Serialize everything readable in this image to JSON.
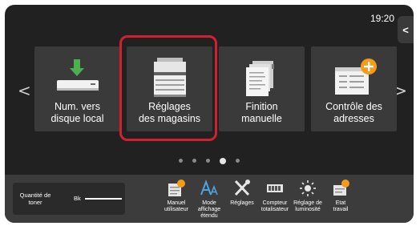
{
  "status": {
    "time": "19:20"
  },
  "side_panel": {
    "toggle_glyph": "<"
  },
  "nav": {
    "prev_glyph": "<",
    "next_glyph": ">"
  },
  "tiles": [
    {
      "label": "Num. vers\ndisque local",
      "icon": "scan-to-local-drive-icon",
      "accent": "#4caf50"
    },
    {
      "label": "Réglages\ndes magasins",
      "icon": "paper-tray-settings-icon",
      "highlighted": true,
      "highlight_color": "#d3202f"
    },
    {
      "label": "Finition\nmanuelle",
      "icon": "manual-finishing-icon"
    },
    {
      "label": "Contrôle des\nadresses",
      "icon": "address-control-icon",
      "accent": "#f59b1a"
    }
  ],
  "pager": {
    "pages": 5,
    "current": 4
  },
  "bottom": {
    "toner": {
      "label": "Quantité de\ntoner",
      "color_label": "Bk",
      "level_fraction": 1.0
    },
    "buttons": [
      {
        "label": "Manuel\nutilisateur",
        "icon": "manual-icon"
      },
      {
        "label": "Mode\naffichage\nétendu",
        "icon": "font-size-icon"
      },
      {
        "label": "Réglages",
        "icon": "tools-icon"
      },
      {
        "label": "Compteur\ntotalisateur",
        "icon": "counter-icon"
      },
      {
        "label": "Réglage de\nluminosité",
        "icon": "brightness-icon"
      },
      {
        "label": "Etat\ntravail",
        "icon": "job-status-icon"
      }
    ]
  }
}
